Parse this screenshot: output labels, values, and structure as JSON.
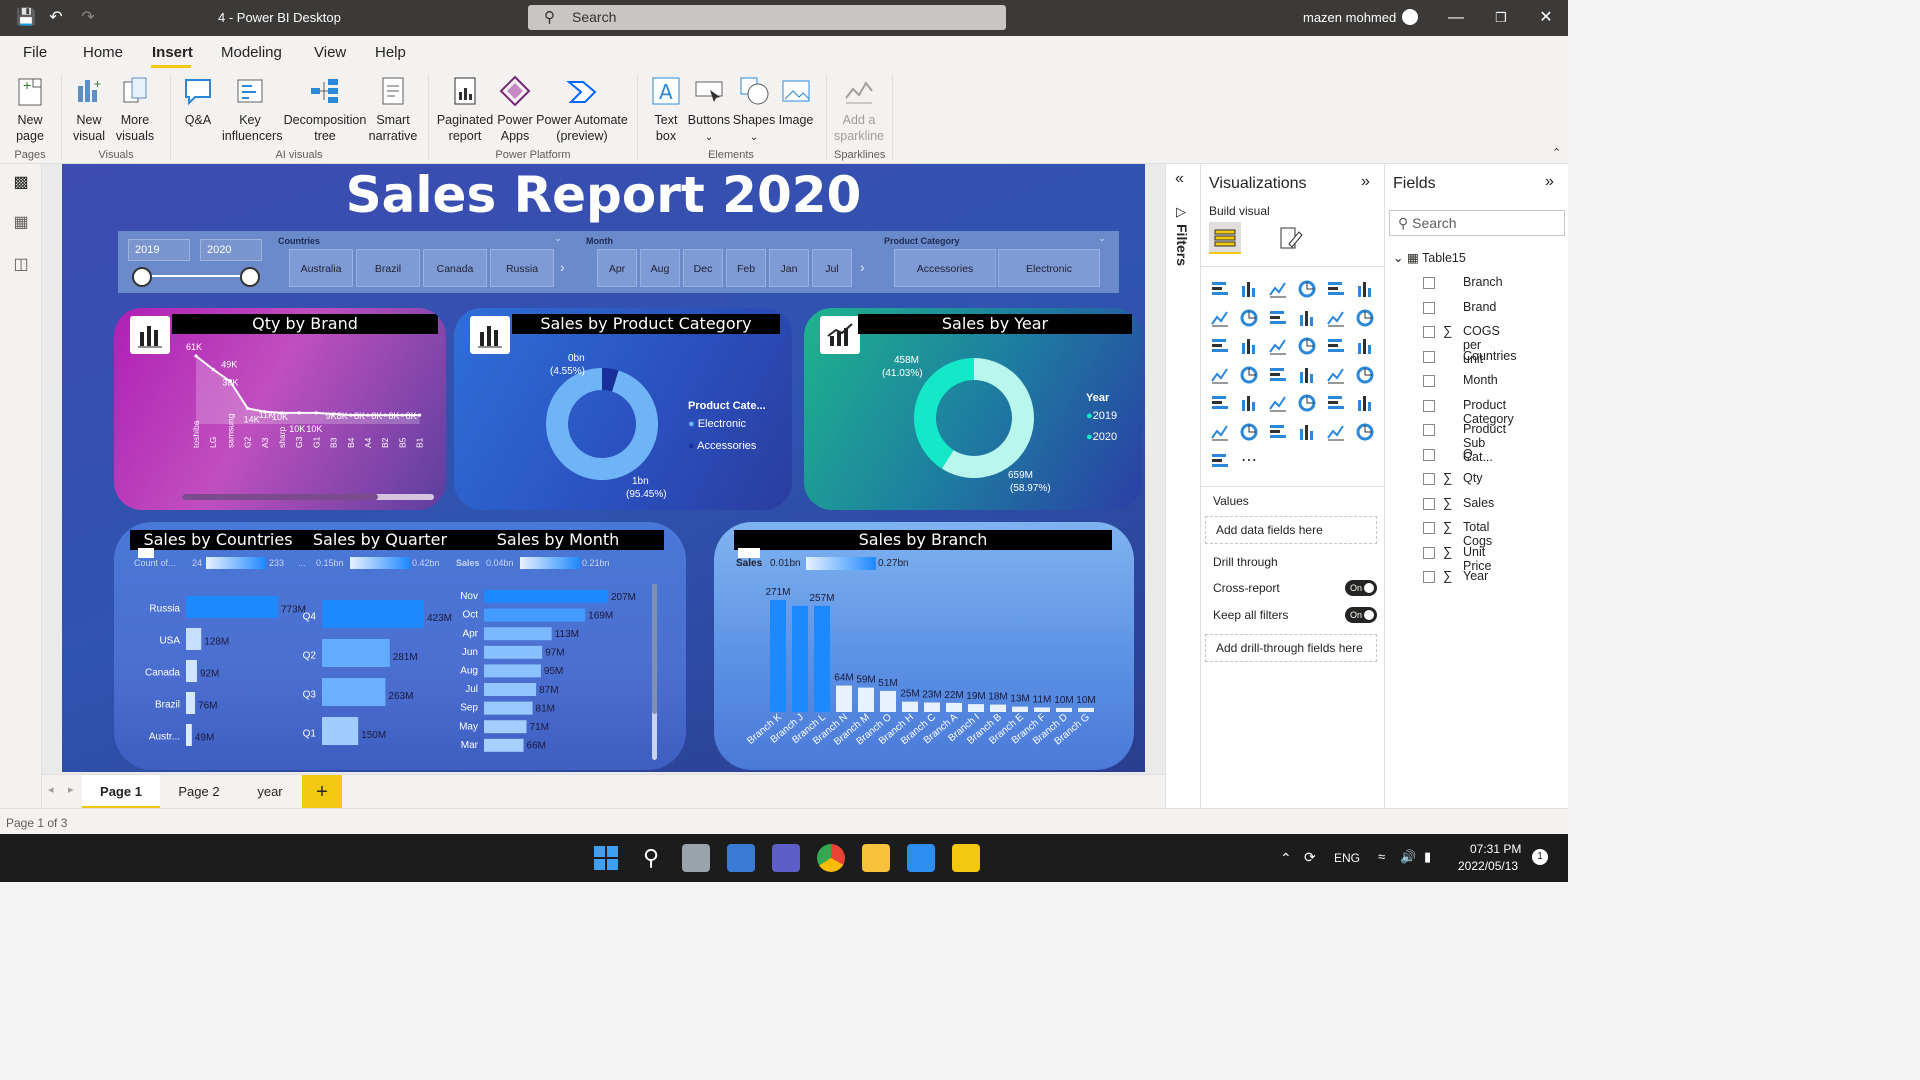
{
  "window": {
    "title": "4 - Power BI Desktop",
    "search_placeholder": "Search",
    "user": "mazen mohmed"
  },
  "menu": [
    "File",
    "Home",
    "Insert",
    "Modeling",
    "View",
    "Help"
  ],
  "ribbon": {
    "buttons": [
      {
        "label": "New\npage",
        "group": "Pages"
      },
      {
        "label": "New\nvisual",
        "group": "Visuals"
      },
      {
        "label": "More\nvisuals",
        "group": "Visuals"
      },
      {
        "label": "Q&A",
        "group": "AI visuals"
      },
      {
        "label": "Key\ninfluencers",
        "group": "AI visuals"
      },
      {
        "label": "Decomposition\ntree",
        "group": "AI visuals"
      },
      {
        "label": "Smart\nnarrative",
        "group": "AI visuals"
      },
      {
        "label": "Paginated\nreport",
        "group": "Power Platform"
      },
      {
        "label": "Power\nApps",
        "group": "Power Platform"
      },
      {
        "label": "Power Automate\n(preview)",
        "group": "Power Platform"
      },
      {
        "label": "Text\nbox",
        "group": "Elements"
      },
      {
        "label": "Buttons",
        "group": "Elements"
      },
      {
        "label": "Shapes",
        "group": "Elements"
      },
      {
        "label": "Image",
        "group": "Elements"
      },
      {
        "label": "Add a\nsparkline",
        "group": "Sparklines"
      }
    ],
    "groups": [
      "Pages",
      "Visuals",
      "AI visuals",
      "Power Platform",
      "Elements",
      "Sparklines"
    ]
  },
  "report": {
    "title": "Sales Report 2020",
    "year_slicer": {
      "from": "2019",
      "to": "2020"
    },
    "slicers": [
      {
        "title": "Countries",
        "items": [
          "Australia",
          "Brazil",
          "Canada",
          "Russia"
        ]
      },
      {
        "title": "Month",
        "items": [
          "Apr",
          "Aug",
          "Dec",
          "Feb",
          "Jan",
          "Jul"
        ]
      },
      {
        "title": "Product Category",
        "items": [
          "Accessories",
          "Electronic"
        ]
      }
    ],
    "cards": {
      "qty_by_brand": "Qty by Brand",
      "sales_by_product_category": "Sales by Product Category",
      "sales_by_year": "Sales by Year",
      "sales_by_countries": "Sales by Countries",
      "sales_by_quarter": "Sales by Quarter",
      "sales_by_month": "Sales by Month",
      "sales_by_branch": "Sales by Branch"
    },
    "legend_pc": {
      "title": "Product Cate...",
      "items": [
        "Electronic",
        "Accessories"
      ]
    },
    "legend_year": {
      "title": "Year",
      "items": [
        "2019",
        "2020"
      ]
    },
    "scales": {
      "countries": {
        "label": "Count of...",
        "min": "24",
        "max": "233"
      },
      "quarter": {
        "label": "...",
        "min": "0.15bn",
        "max": "0.42bn"
      },
      "month": {
        "label": "Sales",
        "min": "0.04bn",
        "max": "0.21bn"
      },
      "branch": {
        "label": "Sales",
        "min": "0.01bn",
        "max": "0.27bn"
      }
    }
  },
  "chart_data": [
    {
      "type": "area",
      "title": "Qty by Brand",
      "categories": [
        "toshiba",
        "LG",
        "samsung",
        "G2",
        "A3",
        "sharp",
        "G3",
        "G1",
        "B3",
        "B4",
        "A4",
        "B2",
        "B5",
        "B1"
      ],
      "values": [
        61000,
        49000,
        38000,
        14000,
        11000,
        10000,
        10000,
        10000,
        9000,
        8000,
        8000,
        8000,
        8000,
        8000
      ],
      "data_labels": [
        "61K",
        "49K",
        "38K",
        "14K",
        "11K",
        "10K",
        "10K",
        "10K",
        "9K",
        "8K",
        "8K",
        "8K",
        "8K",
        "8K"
      ]
    },
    {
      "type": "pie",
      "title": "Sales by Product Category",
      "categories": [
        "Electronic",
        "Accessories"
      ],
      "values": [
        1000000000,
        50000000
      ],
      "data_labels": [
        "1bn\n(95.45%)",
        "0bn\n(4.55%)"
      ],
      "colors": [
        "#6fb4f7",
        "#1a2f9a"
      ]
    },
    {
      "type": "pie",
      "title": "Sales by Year",
      "categories": [
        "2019",
        "2020"
      ],
      "values": [
        458000000,
        659000000
      ],
      "data_labels": [
        "458M\n(41.03%)",
        "659M\n(58.97%)"
      ],
      "colors": [
        "#14e8c8",
        "#b9f6ee"
      ]
    },
    {
      "type": "bar",
      "title": "Sales by Countries",
      "categories": [
        "Russia",
        "USA",
        "Canada",
        "Brazil",
        "Austr..."
      ],
      "values": [
        773,
        128,
        92,
        76,
        49
      ],
      "data_labels": [
        "773M",
        "128M",
        "92M",
        "76M",
        "49M"
      ]
    },
    {
      "type": "bar",
      "title": "Sales by Quarter",
      "categories": [
        "Q4",
        "Q2",
        "Q3",
        "Q1"
      ],
      "values": [
        423,
        281,
        263,
        150
      ],
      "data_labels": [
        "423M",
        "281M",
        "263M",
        "150M"
      ]
    },
    {
      "type": "bar",
      "title": "Sales by Month",
      "categories": [
        "Nov",
        "Oct",
        "Apr",
        "Jun",
        "Aug",
        "Jul",
        "Sep",
        "May",
        "Mar"
      ],
      "values": [
        207,
        169,
        113,
        97,
        95,
        87,
        81,
        71,
        66
      ],
      "data_labels": [
        "207M",
        "169M",
        "113M",
        "97M",
        "95M",
        "87M",
        "81M",
        "71M",
        "66M"
      ]
    },
    {
      "type": "bar",
      "title": "Sales by Branch",
      "categories": [
        "Branch K",
        "Branch J",
        "Branch L",
        "Branch N",
        "Branch M",
        "Branch O",
        "Branch H",
        "Branch C",
        "Branch A",
        "Branch I",
        "Branch B",
        "Branch E",
        "Branch F",
        "Branch D",
        "Branch G"
      ],
      "values": [
        271,
        257,
        257,
        64,
        59,
        51,
        25,
        23,
        22,
        19,
        18,
        13,
        11,
        10,
        10
      ],
      "data_labels": [
        "271M",
        "",
        "257M",
        "64M",
        "59M",
        "51M",
        "25M",
        "23M",
        "22M",
        "19M",
        "18M",
        "13M",
        "11M",
        "10M",
        "10M"
      ]
    }
  ],
  "panes": {
    "filters": "Filters",
    "visualizations": {
      "title": "Visualizations",
      "build_visual": "Build visual",
      "values": "Values",
      "add_data_fields": "Add data fields here",
      "drill_through": "Drill through",
      "cross_report": "Cross-report",
      "keep_all_filters": "Keep all filters",
      "toggle_on": "On",
      "add_drill_fields": "Add drill-through fields here"
    },
    "fields": {
      "title": "Fields",
      "search_placeholder": "Search",
      "table": "Table15",
      "items": [
        {
          "name": "Branch",
          "sum": false
        },
        {
          "name": "Brand",
          "sum": false
        },
        {
          "name": "COGS per unit",
          "sum": true
        },
        {
          "name": "Countries",
          "sum": false
        },
        {
          "name": "Month",
          "sum": false
        },
        {
          "name": "Product Category",
          "sum": false
        },
        {
          "name": "Product Sub Cat...",
          "sum": false
        },
        {
          "name": "Q",
          "sum": false
        },
        {
          "name": "Qty",
          "sum": true
        },
        {
          "name": "Sales",
          "sum": true
        },
        {
          "name": "Total Cogs",
          "sum": true
        },
        {
          "name": "Unit Price",
          "sum": true
        },
        {
          "name": "Year",
          "sum": true
        }
      ]
    }
  },
  "page_tabs": [
    "Page 1",
    "Page 2",
    "year"
  ],
  "status": "Page 1 of 3",
  "taskbar": {
    "lang": "ENG",
    "time": "07:31 PM",
    "date": "2022/05/13",
    "notifications": "1"
  },
  "colors": {
    "accent": "#f2c811",
    "titlebar": "#3b3a39"
  }
}
